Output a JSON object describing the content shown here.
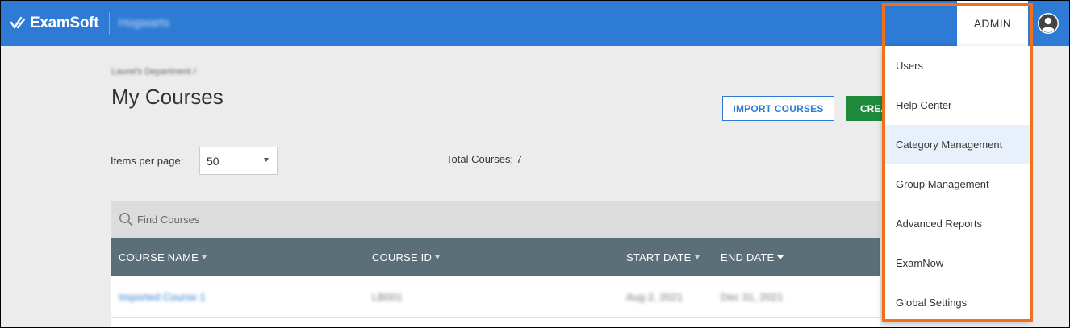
{
  "header": {
    "logo_text": "ExamSoft",
    "org_name": "Hogwarts",
    "admin_tab": "ADMIN",
    "colors": {
      "bar": "#2d7bd4"
    }
  },
  "page": {
    "breadcrumb": "Laurel's Department /",
    "title": "My Courses",
    "import_button": "IMPORT COURSES",
    "create_button": "CREATE COURSE",
    "items_per_page_label": "Items per page:",
    "items_per_page_value": "50",
    "total_courses": "Total Courses: 7"
  },
  "search": {
    "placeholder": "Find Courses"
  },
  "table": {
    "columns": [
      "COURSE NAME",
      "COURSE ID",
      "START DATE",
      "END DATE"
    ],
    "rows": [
      {
        "name": "Imported Course 1",
        "id": "LB001",
        "start": "Aug 2, 2021",
        "end": "Dec 31, 2021"
      }
    ]
  },
  "admin_menu": {
    "items": [
      "Users",
      "Help Center",
      "Category Management",
      "Group Management",
      "Advanced Reports",
      "ExamNow",
      "Global Settings"
    ],
    "highlighted": "Category Management",
    "callout_color": "#f0701e"
  }
}
